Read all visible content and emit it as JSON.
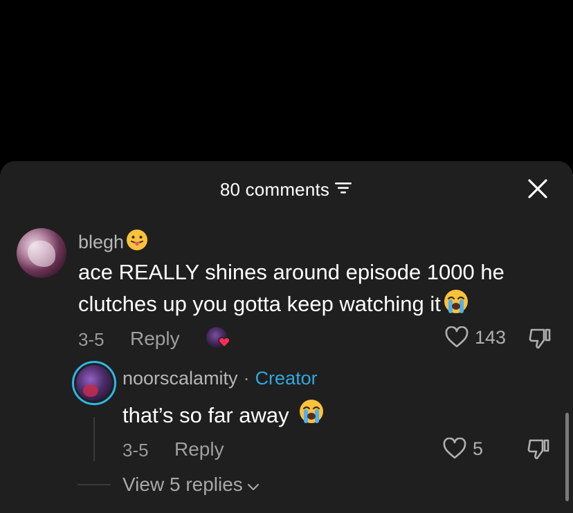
{
  "header": {
    "title": "80 comments"
  },
  "comment": {
    "username": "blegh",
    "text": "ace REALLY shines around episode 1000 he clutches up you gotta keep watching it",
    "date": "3-5",
    "reply_label": "Reply",
    "like_count": "143",
    "username_emoji": "tongue-face-emoji",
    "text_emoji": "loudly-crying-emoji"
  },
  "reply": {
    "username": "noorscalamity",
    "separator": "·",
    "badge": "Creator",
    "text": "that’s so far away",
    "date": "3-5",
    "reply_label": "Reply",
    "like_count": "5",
    "text_emoji": "loudly-crying-emoji"
  },
  "view_replies": {
    "label": "View 5 replies"
  },
  "colors": {
    "sheet_bg": "#1f1f1f",
    "creator_accent": "#2fa8dc",
    "muted_text": "#9a9a9a"
  }
}
